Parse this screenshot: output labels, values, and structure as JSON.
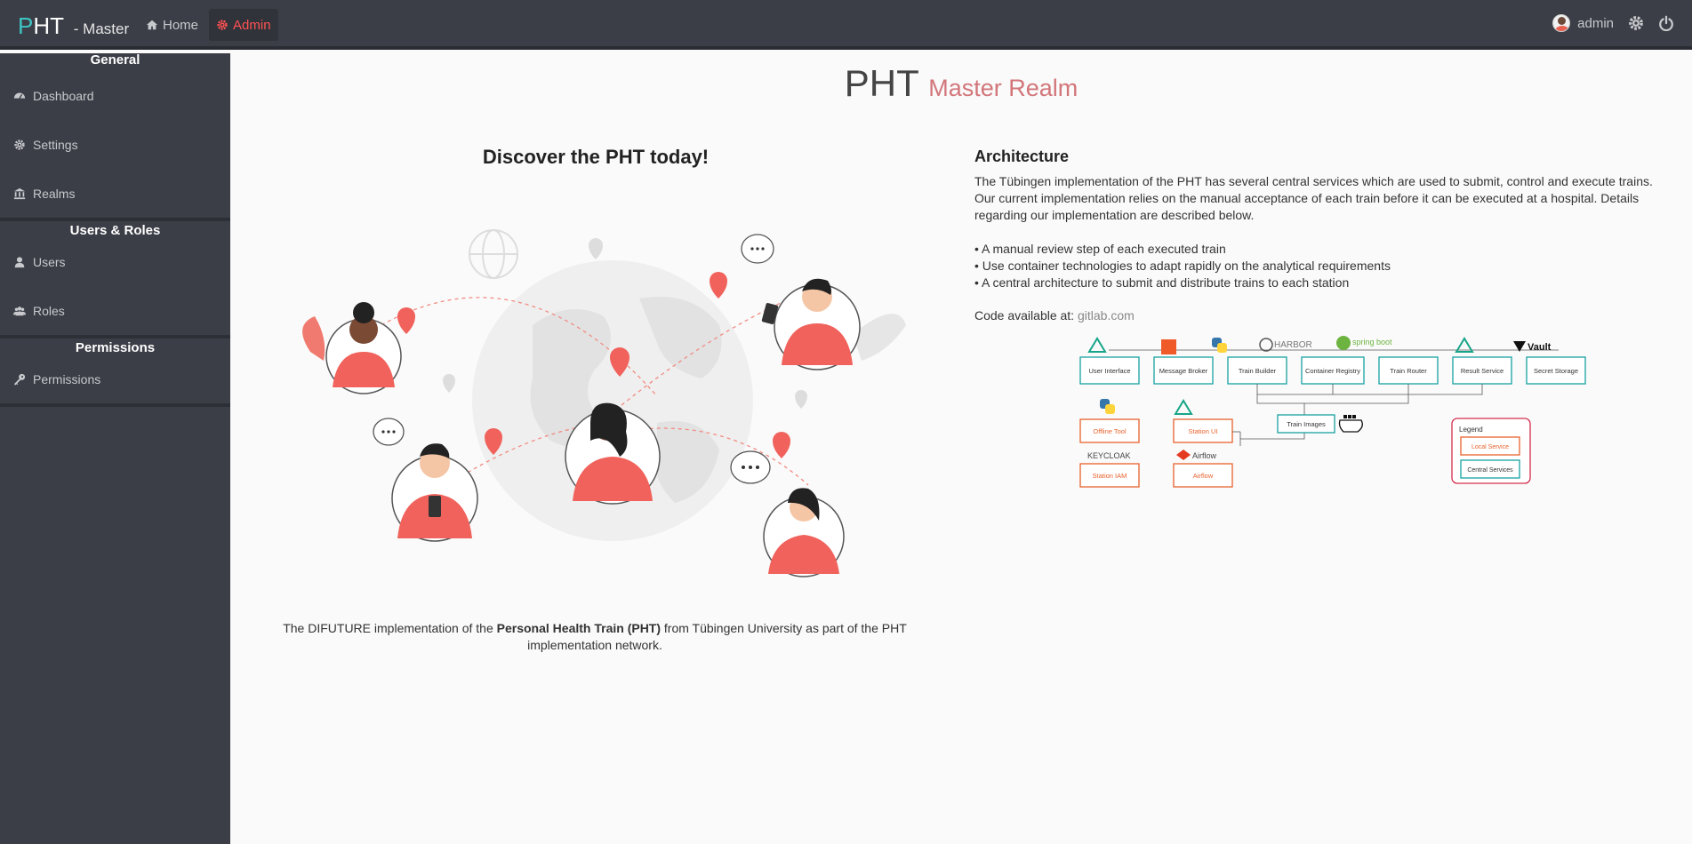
{
  "topbar": {
    "brand_p": "P",
    "brand_ht": "HT",
    "brand_sub": "- Master",
    "nav": [
      {
        "label": "Home",
        "icon": "home-icon"
      },
      {
        "label": "Admin",
        "icon": "cog-icon",
        "active": true
      }
    ],
    "user": "admin"
  },
  "sidebar": {
    "sections": [
      {
        "title": "General",
        "items": [
          {
            "label": "Dashboard",
            "icon": "dashboard-icon"
          },
          {
            "label": "Settings",
            "icon": "gear-icon"
          },
          {
            "label": "Realms",
            "icon": "bank-icon"
          }
        ]
      },
      {
        "title": "Users & Roles",
        "items": [
          {
            "label": "Users",
            "icon": "user-icon"
          },
          {
            "label": "Roles",
            "icon": "users-icon"
          }
        ]
      },
      {
        "title": "Permissions",
        "items": [
          {
            "label": "Permissions",
            "icon": "key-icon"
          }
        ]
      }
    ]
  },
  "main": {
    "title_pht": "PHT",
    "title_realm": "Master Realm",
    "discover": "Discover the PHT today!",
    "caption_before": "The DIFUTURE implementation of the ",
    "caption_bold": "Personal Health Train (PHT)",
    "caption_after": " from Tübingen University as part of the PHT implementation network.",
    "architecture": {
      "title": "Architecture",
      "text": "The Tübingen implementation of the PHT has several central services which are used to submit, control and execute trains. Our current implementation relies on the manual acceptance of each train before it can be executed at a hospital. Details regarding our implementation are described below.",
      "bullets": [
        "• A manual review step of each executed train",
        "• Use container technologies to adapt rapidly on the analytical requirements",
        "• A central architecture to submit and distribute trains to each station"
      ],
      "code_label": "Code available at:",
      "code_link": "gitlab.com"
    },
    "diagram": {
      "central": [
        "User Interface",
        "Message Broker",
        "Train Builder",
        "Container Registry",
        "Train Router",
        "Result Service",
        "Secret Storage"
      ],
      "logos": [
        "HARBOR",
        "spring boot",
        "Vault"
      ],
      "train_images": "Train Images",
      "local": [
        "Offline Tool",
        "Station UI",
        "Station IAM",
        "Airflow"
      ],
      "local_logos": [
        "KEYCLOAK",
        "Airflow"
      ],
      "legend_title": "Legend",
      "legend_local": "Local Service",
      "legend_central": "Central Services"
    }
  }
}
